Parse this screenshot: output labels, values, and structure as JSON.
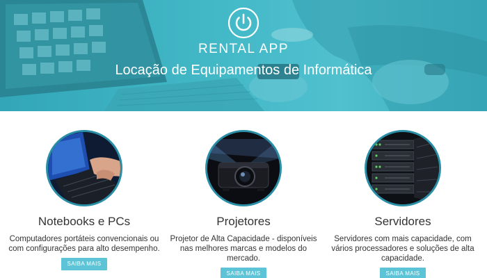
{
  "hero": {
    "brand": "RENTAL APP",
    "tagline": "Locação de Equipamentos de Informática"
  },
  "services": [
    {
      "icon": "notebook-photo",
      "title": "Notebooks e PCs",
      "description": "Computadores portáteis convencionais ou com configurações para alto desempenho.",
      "button": "SAIBA MAIS"
    },
    {
      "icon": "projector-photo",
      "title": "Projetores",
      "description": "Projetor de Alta Capacidade - disponíveis nas melhores marcas e modelos do mercado.",
      "button": "SAIBA MAIS"
    },
    {
      "icon": "server-rack-photo",
      "title": "Servidores",
      "description": "Servidores com mais capacidade, com vários processadores e soluções de alta capacidade.",
      "button": "SAIBA MAIS"
    }
  ],
  "colors": {
    "hero_teal": "#47b6c4",
    "button": "#5cc4d6",
    "circle_border": "#2a8fa6",
    "text": "#333333"
  }
}
